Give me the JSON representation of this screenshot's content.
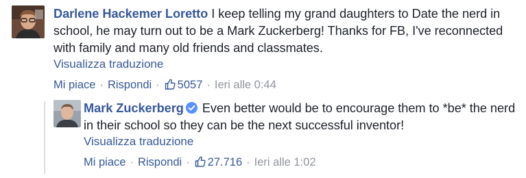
{
  "comments": [
    {
      "author": "Darlene Hackemer Loretto",
      "text": "I keep telling my grand daughters to Date the nerd in school, he may turn out to be a Mark Zuckerberg! Thanks for FB, I've reconnected with family and many old friends and classmates.",
      "translate_label": "Visualizza traduzione",
      "like_label": "Mi piace",
      "reply_label": "Rispondi",
      "like_count": "5057",
      "timestamp": "Ieri alle 0:44"
    },
    {
      "author": "Mark Zuckerberg",
      "verified": true,
      "text": "Even better would be to encourage them to *be* the nerd in their school so they can be the next successful inventor!",
      "translate_label": "Visualizza traduzione",
      "like_label": "Mi piace",
      "reply_label": "Rispondi",
      "like_count": "27.716",
      "timestamp": "Ieri alle 1:02"
    }
  ],
  "icons": {
    "like": "thumbs-up-icon",
    "verified": "verified-badge-icon"
  },
  "colors": {
    "link": "#365899",
    "meta": "#90949c",
    "text": "#1d2129",
    "verified": "#5890ff"
  }
}
